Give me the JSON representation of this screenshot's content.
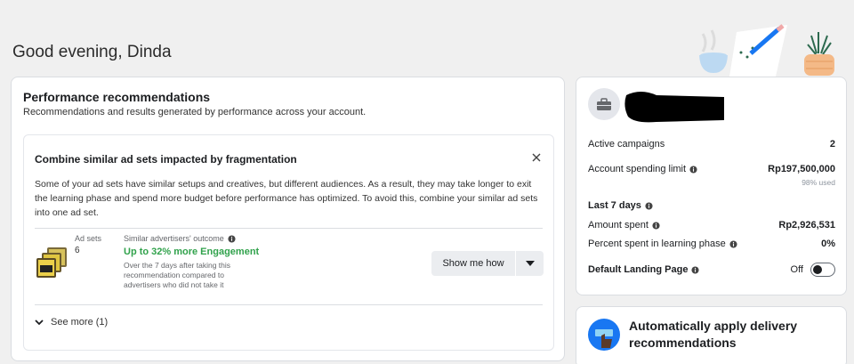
{
  "greeting": "Good evening, Dinda",
  "performance": {
    "title": "Performance recommendations",
    "subtitle": "Recommendations and results generated by performance across your account.",
    "recommendation": {
      "title": "Combine similar ad sets impacted by fragmentation",
      "description": "Some of your ad sets have similar setups and creatives, but different audiences. As a result, they may take longer to exit the learning phase and spend more budget before performance has optimized. To avoid this, combine your similar ad sets into one ad set.",
      "adsets_label": "Ad sets",
      "adsets_count": "6",
      "outcome_label": "Similar advertisers' outcome",
      "outcome_value": "Up to 32% more Engagement",
      "outcome_note": "Over the 7 days after taking this recommendation compared to advertisers who did not take it",
      "show_button": "Show me how",
      "see_more": "See more (1)"
    }
  },
  "account": {
    "rows": {
      "active_campaigns_label": "Active campaigns",
      "active_campaigns_value": "2",
      "spending_limit_label": "Account spending limit",
      "spending_limit_value": "Rp197,500,000",
      "spending_used": "98% used",
      "last7_label": "Last 7 days",
      "amount_spent_label": "Amount spent",
      "amount_spent_value": "Rp2,926,531",
      "percent_learning_label": "Percent spent in learning phase",
      "percent_learning_value": "0%",
      "landing_label": "Default Landing Page",
      "landing_value": "Off"
    }
  },
  "auto_apply": {
    "title": "Automatically apply delivery recommendations"
  },
  "colors": {
    "accent_green": "#31a24c",
    "card_border": "#dadde1",
    "button_bg": "#ebedf0"
  }
}
